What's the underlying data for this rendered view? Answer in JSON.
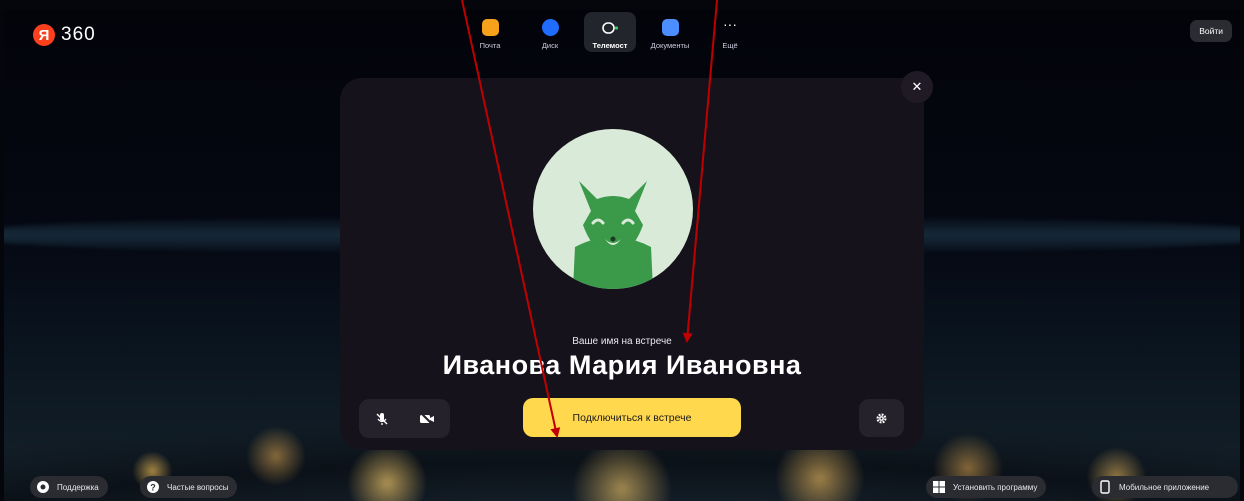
{
  "header": {
    "logo_badge": "Я",
    "logo_text": "360",
    "nav": [
      {
        "label": "Почта",
        "icon": "mail-icon",
        "color": "#f7a21b"
      },
      {
        "label": "Диск",
        "icon": "disk-icon",
        "color": "#1f6cff"
      },
      {
        "label": "Телемост",
        "icon": "telemost-icon",
        "color": "#2b2e35",
        "active": true
      },
      {
        "label": "Документы",
        "icon": "documents-icon",
        "color": "#4c8dff"
      },
      {
        "label": "Ещё",
        "icon": "more-icon",
        "color": "#ffffff"
      }
    ],
    "login_label": "Войти"
  },
  "modal": {
    "name_label": "Ваше имя на встрече",
    "name": "Иванова Мария Ивановна",
    "join_label": "Подключиться к встрече",
    "avatar_icon": "fox-avatar-icon"
  },
  "footer": {
    "support_label": "Поддержка",
    "faq_label": "Частые вопросы",
    "install_label": "Установить программу",
    "mobile_label": "Мобильное приложение"
  },
  "colors": {
    "accent_yellow": "#ffd84e",
    "brand_red": "#fc3f1d",
    "annotation_arrow": "#c00000",
    "fox_green": "#3a9a4a"
  }
}
